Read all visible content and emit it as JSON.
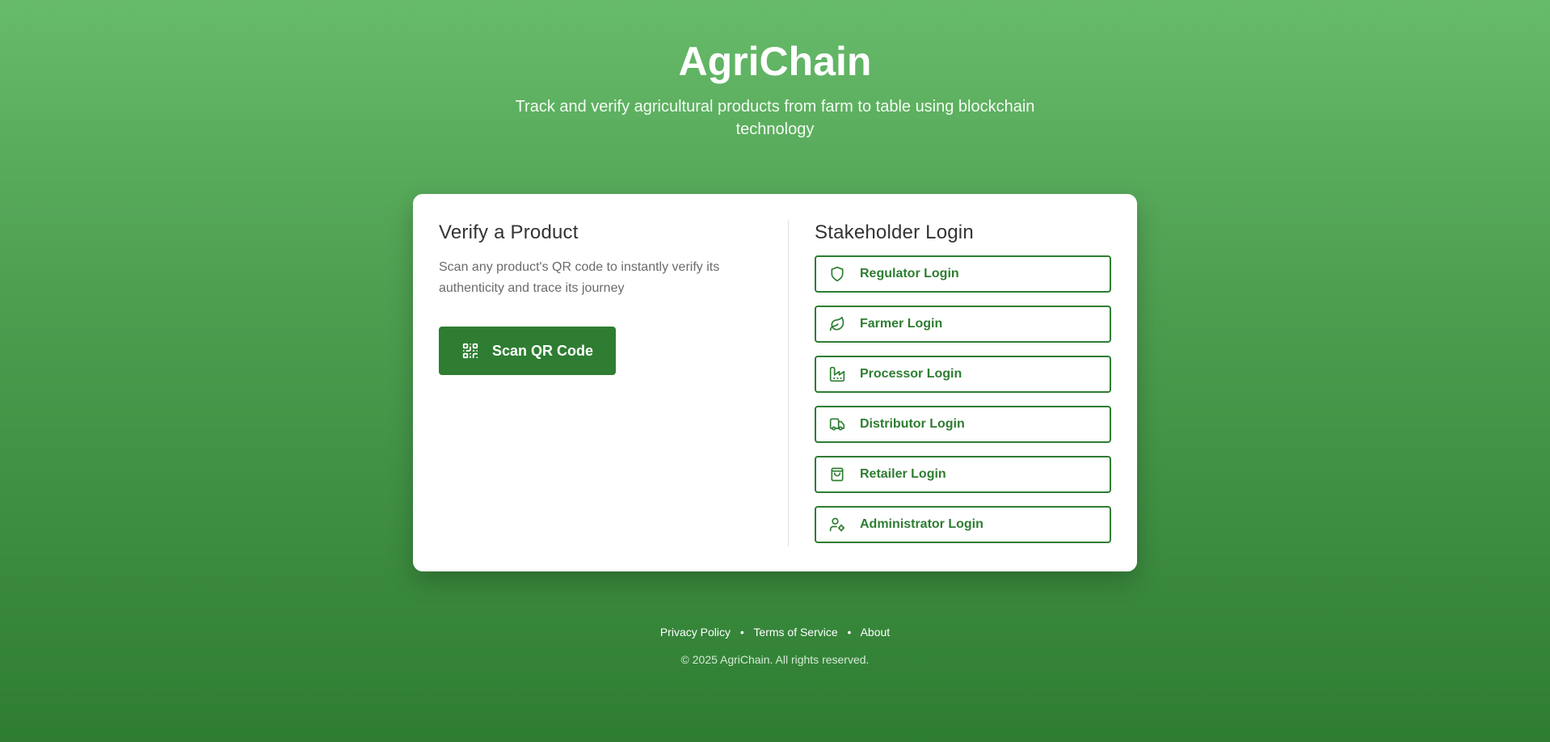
{
  "header": {
    "title": "AgriChain",
    "subtitle": "Track and verify agricultural products from farm to table using blockchain technology"
  },
  "verify": {
    "title": "Verify a Product",
    "description": "Scan any product's QR code to instantly verify its authenticity and trace its journey",
    "scan_button_label": "Scan QR Code",
    "scan_button_icon": "qr-code-icon"
  },
  "stakeholder": {
    "title": "Stakeholder Login",
    "logins": [
      {
        "label": "Regulator Login",
        "icon": "shield-icon"
      },
      {
        "label": "Farmer Login",
        "icon": "leaf-icon"
      },
      {
        "label": "Processor Login",
        "icon": "factory-icon"
      },
      {
        "label": "Distributor Login",
        "icon": "truck-icon"
      },
      {
        "label": "Retailer Login",
        "icon": "shopping-bag-icon"
      },
      {
        "label": "Administrator Login",
        "icon": "user-cog-icon"
      }
    ]
  },
  "footer": {
    "links": [
      "Privacy Policy",
      "Terms of Service",
      "About"
    ],
    "separator": "•",
    "copyright": "© 2025 AgriChain. All rights reserved."
  },
  "colors": {
    "primary": "#2e7d32",
    "background_top": "#66bb6a",
    "background_bottom": "#2e7d32"
  }
}
